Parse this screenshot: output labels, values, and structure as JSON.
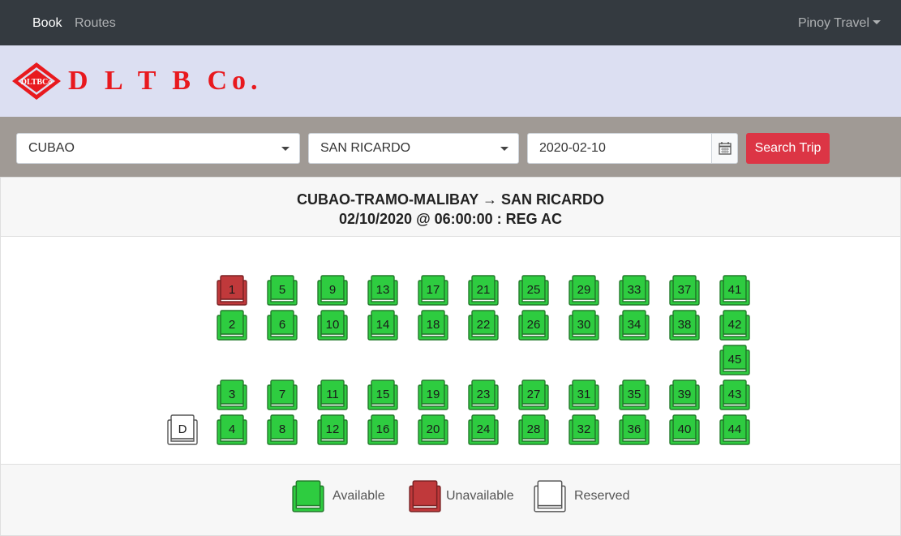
{
  "nav": {
    "book": "Book",
    "routes": "Routes",
    "user": "Pinoy Travel"
  },
  "brand": {
    "logo_text": "D L T B Co.",
    "emblem_text": "DLTBCo",
    "color": "#e8191e"
  },
  "search": {
    "origin": "CUBAO",
    "destination": "SAN RICARDO",
    "date": "2020-02-10",
    "button": "Search Trip",
    "calendar_icon": "calendar-icon"
  },
  "trip": {
    "route": "CUBAO-TRAMO-MALIBAY → SAN RICARDO",
    "schedule": "02/10/2020 @ 06:00:00 : REG AC"
  },
  "seats": {
    "driver": {
      "label": "D",
      "status": "reserved"
    },
    "unavailable": [
      "1"
    ],
    "seat_numbers": [
      "1",
      "2",
      "3",
      "4",
      "5",
      "6",
      "7",
      "8",
      "9",
      "10",
      "11",
      "12",
      "13",
      "14",
      "15",
      "16",
      "17",
      "18",
      "19",
      "20",
      "21",
      "22",
      "23",
      "24",
      "25",
      "26",
      "27",
      "28",
      "29",
      "30",
      "31",
      "32",
      "33",
      "34",
      "35",
      "36",
      "37",
      "38",
      "39",
      "40",
      "41",
      "42",
      "43",
      "44",
      "45"
    ]
  },
  "legend": {
    "available": "Available",
    "unavailable": "Unavailable",
    "reserved": "Reserved"
  },
  "colors": {
    "available": "#2ecc40",
    "unavailable": "#c0393b",
    "reserved": "#ffffff",
    "search_button": "#dc3545"
  }
}
